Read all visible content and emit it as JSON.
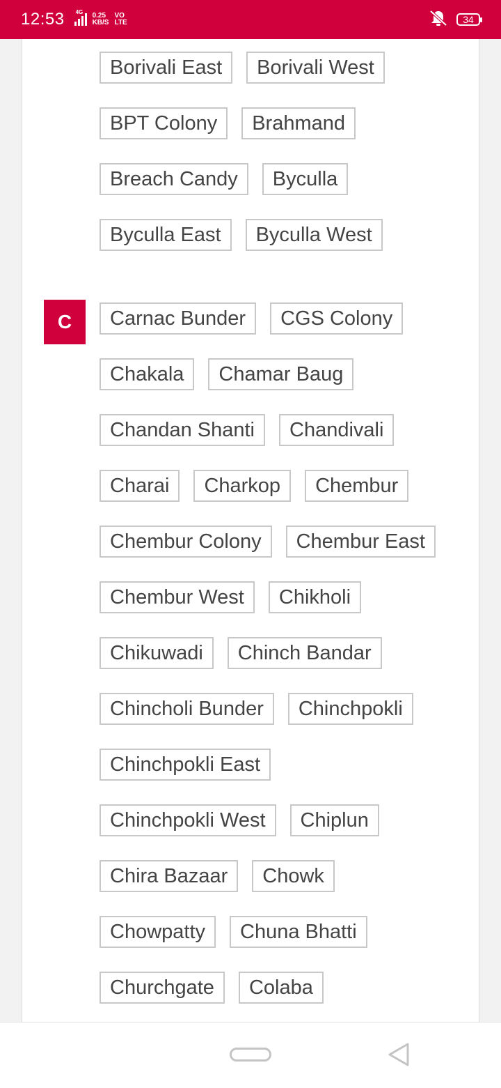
{
  "status_bar": {
    "time": "12:53",
    "network": "4G",
    "speed_value": "0.25",
    "speed_unit": "KB/S",
    "volte_top": "VO",
    "volte_bottom": "LTE",
    "battery": "34",
    "icons": [
      "signal-icon",
      "mute-icon",
      "battery-icon"
    ]
  },
  "colors": {
    "accent": "#d0003c",
    "chip_border": "#c8c8c8",
    "chip_text": "#444444"
  },
  "sections": [
    {
      "letter": "",
      "rows": [
        [
          "Borivali East",
          "Borivali West"
        ],
        [
          "BPT Colony",
          "Brahmand"
        ],
        [
          "Breach Candy",
          "Byculla"
        ],
        [
          "Byculla East",
          "Byculla West"
        ]
      ]
    },
    {
      "letter": "C",
      "rows": [
        [
          "Carnac Bunder",
          "CGS Colony"
        ],
        [
          "Chakala",
          "Chamar Baug"
        ],
        [
          "Chandan Shanti",
          "Chandivali"
        ],
        [
          "Charai",
          "Charkop",
          "Chembur"
        ],
        [
          "Chembur Colony",
          "Chembur East"
        ],
        [
          "Chembur West",
          "Chikholi"
        ],
        [
          "Chikuwadi",
          "Chinch Bandar"
        ],
        [
          "Chincholi Bunder",
          "Chinchpokli"
        ],
        [
          "Chinchpokli East"
        ],
        [
          "Chinchpokli West",
          "Chiplun"
        ],
        [
          "Chira Bazaar",
          "Chowk"
        ],
        [
          "Chowpatty",
          "Chuna Bhatti"
        ],
        [
          "Churchgate",
          "Colaba"
        ]
      ]
    }
  ],
  "nav_bar": {
    "icons": [
      "home-pill-icon",
      "back-triangle-icon"
    ]
  }
}
